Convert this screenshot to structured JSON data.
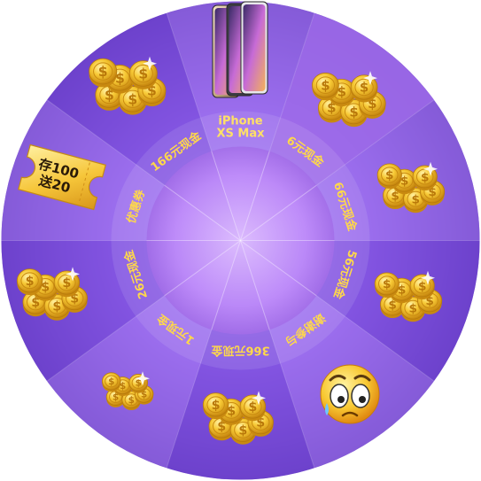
{
  "wheel": {
    "segments": [
      {
        "label": "iPhone",
        "label2": "XS Max",
        "prize_icon": "iphone-xs-max-image"
      },
      {
        "label": "6元现金",
        "prize_icon": "gold-coins-pile-icon"
      },
      {
        "label": "66元现金",
        "prize_icon": "gold-coins-pile-icon"
      },
      {
        "label": "56元现金",
        "prize_icon": "gold-coins-pile-icon"
      },
      {
        "label": "谢谢参与",
        "prize_icon": "crying-face-icon"
      },
      {
        "label": "366元现金",
        "prize_icon": "gold-coins-pile-icon"
      },
      {
        "label": "1元现金",
        "prize_icon": "gold-coins-small-icon"
      },
      {
        "label": "26元现金",
        "prize_icon": "gold-coins-pile-icon"
      },
      {
        "label": "优惠券",
        "prize_icon": "coupon-ticket-icon",
        "ticket_line1": "存100",
        "ticket_line2": "送20"
      },
      {
        "label": "166元现金",
        "prize_icon": "gold-coins-pile-icon"
      }
    ],
    "colors": {
      "segment_a": "#7b4fdc",
      "segment_b": "#a77cf2",
      "highlight": "#d79bff",
      "label": "#ffd84a",
      "coin": "#f5c12e",
      "coin_dark": "#c98a10"
    }
  }
}
